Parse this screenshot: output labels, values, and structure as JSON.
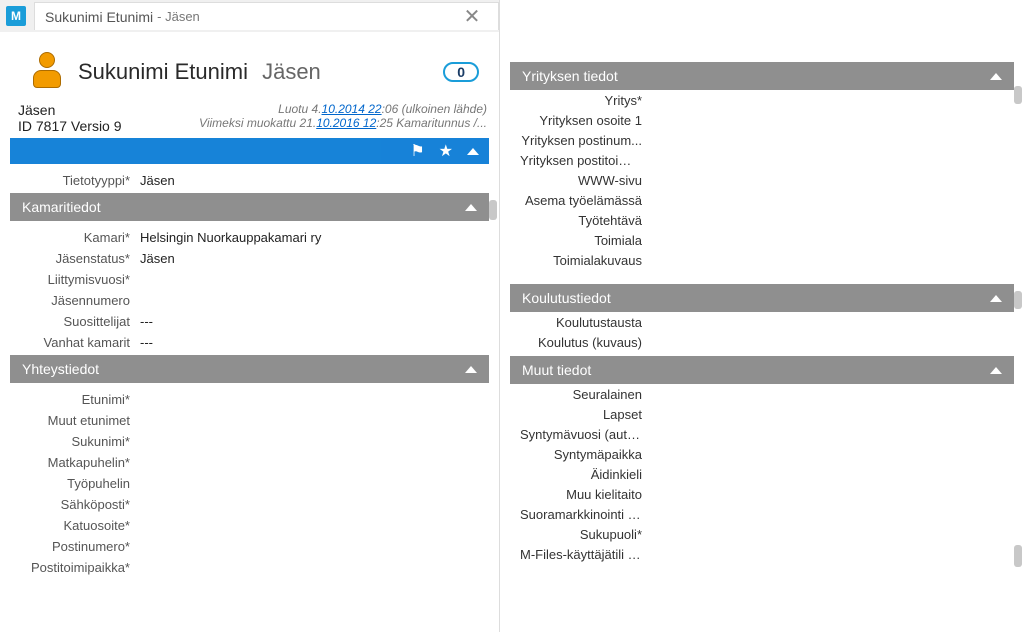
{
  "tab": {
    "app_letter": "M",
    "name": "Sukunimi Etunimi",
    "suffix": "- Jäsen",
    "close": "✕"
  },
  "card": {
    "title": "Sukunimi Etunimi",
    "subtitle": "Jäsen",
    "badge": "0"
  },
  "meta": {
    "type": "Jäsen",
    "id_line": "ID 7817  Versio 9",
    "created_prefix": "Luotu 4.",
    "created_link": "10.2014 22",
    "created_suffix": ":06 (ulkoinen lähde)",
    "modified_prefix": "Viimeksi muokattu 21.",
    "modified_link": "10.2016 12",
    "modified_suffix": ":25 Kamaritunnus /..."
  },
  "left": {
    "tietotyyppi_label": "Tietotyyppi*",
    "tietotyyppi_value": "Jäsen",
    "section_kamaritiedot": "Kamaritiedot",
    "kamari_label": "Kamari*",
    "kamari_value": "Helsingin Nuorkauppakamari ry",
    "jasenstatus_label": "Jäsenstatus*",
    "jasenstatus_value": "Jäsen",
    "liittymisvuosi_label": "Liittymisvuosi*",
    "jasennumero_label": "Jäsennumero",
    "suosittelijat_label": "Suosittelijat",
    "suosittelijat_value": "---",
    "vanhatkamarit_label": "Vanhat kamarit",
    "vanhatkamarit_value": "---",
    "section_yhteystiedot": "Yhteystiedot",
    "etunimi_label": "Etunimi*",
    "muut_etunimet_label": "Muut etunimet",
    "sukunimi_label": "Sukunimi*",
    "matkapuhelin_label": "Matkapuhelin*",
    "tyopuhelin_label": "Työpuhelin",
    "sahkoposti_label": "Sähköposti*",
    "katuosoite_label": "Katuosoite*",
    "postinumero_label": "Postinumero*",
    "postitoimipaikka_label": "Postitoimipaikka*"
  },
  "right": {
    "section_yrityksen": "Yrityksen tiedot",
    "yritys_label": "Yritys*",
    "yrityksen_osoite_label": "Yrityksen osoite 1",
    "yrityksen_postinum_label": "Yrityksen postinum...",
    "yrityksen_postitoimi_label": "Yrityksen postitoimi...",
    "www_label": "WWW-sivu",
    "asema_label": "Asema työelämässä",
    "tyotehtava_label": "Työtehtävä",
    "toimiala_label": "Toimiala",
    "toimialakuvaus_label": "Toimialakuvaus",
    "section_koulutus": "Koulutustiedot",
    "koulutustausta_label": "Koulutustausta",
    "koulutus_kuvaus_label": "Koulutus (kuvaus)",
    "section_muut": "Muut tiedot",
    "seuralainen_label": "Seuralainen",
    "lapset_label": "Lapset",
    "syntymavuosi_label": "Syntymävuosi (auto...",
    "syntymapaikka_label": "Syntymäpaikka",
    "aidinkieli_label": "Äidinkieli",
    "muu_kielitaito_label": "Muu kielitaito",
    "suoramarkkinointi_label": "Suoramarkkinointi s...",
    "sukupuoli_label": "Sukupuoli*",
    "mfiles_label": "M-Files-käyttäjätili (..."
  }
}
